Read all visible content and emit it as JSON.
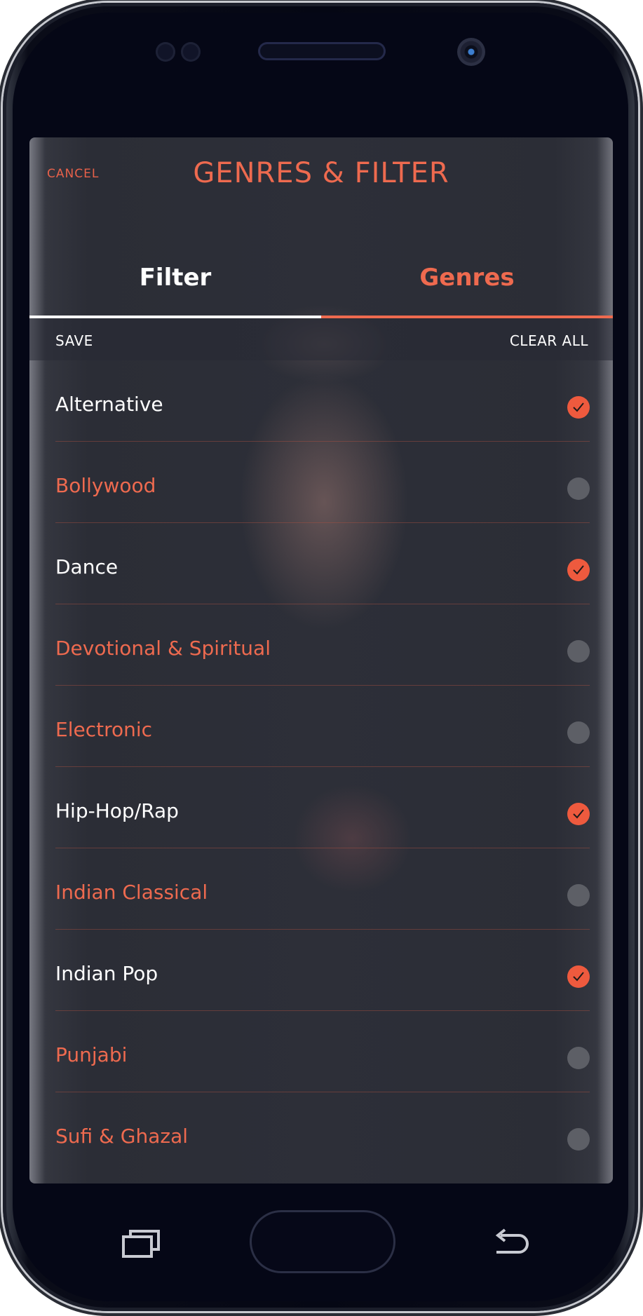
{
  "header": {
    "cancel_label": "CANCEL",
    "title": "GENRES & FILTER"
  },
  "tabs": [
    {
      "label": "Filter",
      "active": false
    },
    {
      "label": "Genres",
      "active": true
    }
  ],
  "actions": {
    "save_label": "SAVE",
    "clear_label": "CLEAR ALL"
  },
  "genres": [
    {
      "label": "Alternative",
      "checked": true
    },
    {
      "label": "Bollywood",
      "checked": false
    },
    {
      "label": "Dance",
      "checked": true
    },
    {
      "label": "Devotional & Spiritual",
      "checked": false
    },
    {
      "label": "Electronic",
      "checked": false
    },
    {
      "label": "Hip-Hop/Rap",
      "checked": true
    },
    {
      "label": "Indian Classical",
      "checked": false
    },
    {
      "label": "Indian Pop",
      "checked": true
    },
    {
      "label": "Punjabi",
      "checked": false
    },
    {
      "label": "Sufi & Ghazal",
      "checked": false
    }
  ],
  "colors": {
    "accent": "#ee6a4f",
    "check_on": "#ee5a3e",
    "check_off": "#5d5f66",
    "text_selected": "#ffffff"
  },
  "icons": {
    "check": "check-icon",
    "recent_apps": "recent-apps-icon",
    "back": "back-arrow-icon"
  }
}
